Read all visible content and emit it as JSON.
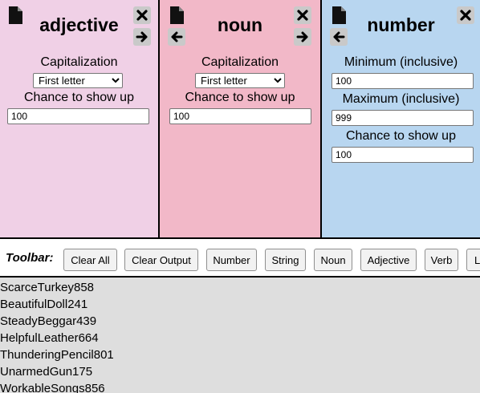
{
  "panels": {
    "adjective": {
      "title": "adjective",
      "capitalization_label": "Capitalization",
      "capitalization_value": "First letter",
      "chance_label": "Chance to show up",
      "chance_value": "100",
      "icons": [
        "document-icon",
        "close-icon",
        "arrow-right-icon"
      ]
    },
    "noun": {
      "title": "noun",
      "capitalization_label": "Capitalization",
      "capitalization_value": "First letter",
      "chance_label": "Chance to show up",
      "chance_value": "100",
      "icons": [
        "document-icon",
        "arrow-left-icon",
        "close-icon",
        "arrow-right-icon"
      ]
    },
    "number": {
      "title": "number",
      "min_label": "Minimum (inclusive)",
      "min_value": "100",
      "max_label": "Maximum (inclusive)",
      "max_value": "999",
      "chance_label": "Chance to show up",
      "chance_value": "100",
      "icons": [
        "document-icon",
        "arrow-left-icon",
        "close-icon"
      ]
    }
  },
  "toolbar": {
    "label": "Toolbar:",
    "buttons": [
      "Clear All",
      "Clear Output",
      "Number",
      "String",
      "Noun",
      "Adjective",
      "Verb",
      "L"
    ]
  },
  "output": [
    "ScarceTurkey858",
    "BeautifulDoll241",
    "SteadyBeggar439",
    "HelpfulLeather664",
    "ThunderingPencil801",
    "UnarmedGun175",
    "WorkableSongs856"
  ],
  "colors": {
    "adjective_bg": "#f0d0e6",
    "noun_bg": "#f2b8c8",
    "number_bg": "#b8d6f0",
    "output_bg": "#dedede"
  }
}
